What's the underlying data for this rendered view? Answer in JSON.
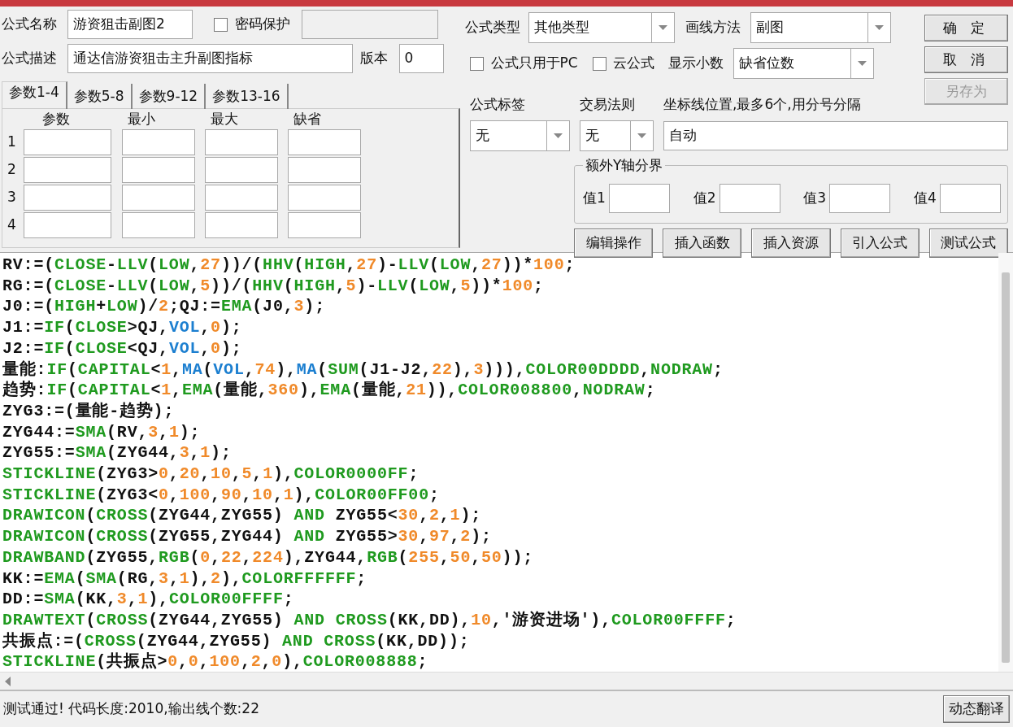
{
  "formula_name": {
    "label": "公式名称",
    "value": "游资狙击副图2"
  },
  "password_protect": {
    "label": "密码保护",
    "checked": false,
    "field_disabled": true
  },
  "description": {
    "label": "公式描述",
    "value": "通达信游资狙击主升副图指标"
  },
  "version": {
    "label": "版本",
    "value": "0"
  },
  "param_tabs": [
    {
      "label": "参数1-4",
      "selected": true
    },
    {
      "label": "参数5-8",
      "selected": false
    },
    {
      "label": "参数9-12",
      "selected": false
    },
    {
      "label": "参数13-16",
      "selected": false
    }
  ],
  "param_table": {
    "columns": [
      "参数",
      "最小",
      "最大",
      "缺省"
    ],
    "rows": [
      "1",
      "2",
      "3",
      "4"
    ]
  },
  "formula_type": {
    "label": "公式类型",
    "value": "其他类型"
  },
  "draw_method": {
    "label": "画线方法",
    "value": "副图"
  },
  "pc_only": {
    "label": "公式只用于PC",
    "checked": false
  },
  "cloud": {
    "label": "云公式",
    "checked": false
  },
  "decimals": {
    "label": "显示小数",
    "value": "缺省位数"
  },
  "side_buttons": [
    {
      "label": "确 定",
      "disabled": false
    },
    {
      "label": "取 消",
      "disabled": false
    },
    {
      "label": "另存为",
      "disabled": true
    }
  ],
  "formula_tag": {
    "label": "公式标签",
    "value": "无"
  },
  "trade_rule": {
    "label": "交易法则",
    "value": "无"
  },
  "axis_lines": {
    "label": "坐标线位置,最多6个,用分号分隔",
    "value": "自动"
  },
  "extra_y": {
    "title": "额外Y轴分界",
    "fields": [
      "值1",
      "值2",
      "值3",
      "值4"
    ]
  },
  "tool_buttons": [
    "编辑操作",
    "插入函数",
    "插入资源",
    "引入公式",
    "测试公式"
  ],
  "code_lines": [
    [
      {
        "kind": "plain",
        "text": "RV:=("
      },
      {
        "kind": "func",
        "text": "CLOSE"
      },
      {
        "kind": "plain",
        "text": "-"
      },
      {
        "kind": "func",
        "text": "LLV"
      },
      {
        "kind": "plain",
        "text": "("
      },
      {
        "kind": "func",
        "text": "LOW"
      },
      {
        "kind": "plain",
        "text": ","
      },
      {
        "kind": "num",
        "text": "27"
      },
      {
        "kind": "plain",
        "text": "))/("
      },
      {
        "kind": "func",
        "text": "HHV"
      },
      {
        "kind": "plain",
        "text": "("
      },
      {
        "kind": "func",
        "text": "HIGH"
      },
      {
        "kind": "plain",
        "text": ","
      },
      {
        "kind": "num",
        "text": "27"
      },
      {
        "kind": "plain",
        "text": ")-"
      },
      {
        "kind": "func",
        "text": "LLV"
      },
      {
        "kind": "plain",
        "text": "("
      },
      {
        "kind": "func",
        "text": "LOW"
      },
      {
        "kind": "plain",
        "text": ","
      },
      {
        "kind": "num",
        "text": "27"
      },
      {
        "kind": "plain",
        "text": "))*"
      },
      {
        "kind": "num",
        "text": "100"
      },
      {
        "kind": "plain",
        "text": ";"
      }
    ],
    [
      {
        "kind": "plain",
        "text": "RG:=("
      },
      {
        "kind": "func",
        "text": "CLOSE"
      },
      {
        "kind": "plain",
        "text": "-"
      },
      {
        "kind": "func",
        "text": "LLV"
      },
      {
        "kind": "plain",
        "text": "("
      },
      {
        "kind": "func",
        "text": "LOW"
      },
      {
        "kind": "plain",
        "text": ","
      },
      {
        "kind": "num",
        "text": "5"
      },
      {
        "kind": "plain",
        "text": "))/("
      },
      {
        "kind": "func",
        "text": "HHV"
      },
      {
        "kind": "plain",
        "text": "("
      },
      {
        "kind": "func",
        "text": "HIGH"
      },
      {
        "kind": "plain",
        "text": ","
      },
      {
        "kind": "num",
        "text": "5"
      },
      {
        "kind": "plain",
        "text": ")-"
      },
      {
        "kind": "func",
        "text": "LLV"
      },
      {
        "kind": "plain",
        "text": "("
      },
      {
        "kind": "func",
        "text": "LOW"
      },
      {
        "kind": "plain",
        "text": ","
      },
      {
        "kind": "num",
        "text": "5"
      },
      {
        "kind": "plain",
        "text": "))*"
      },
      {
        "kind": "num",
        "text": "100"
      },
      {
        "kind": "plain",
        "text": ";"
      }
    ],
    [
      {
        "kind": "plain",
        "text": "J0:=("
      },
      {
        "kind": "func",
        "text": "HIGH"
      },
      {
        "kind": "plain",
        "text": "+"
      },
      {
        "kind": "func",
        "text": "LOW"
      },
      {
        "kind": "plain",
        "text": ")/"
      },
      {
        "kind": "num",
        "text": "2"
      },
      {
        "kind": "plain",
        "text": ";QJ:="
      },
      {
        "kind": "func",
        "text": "EMA"
      },
      {
        "kind": "plain",
        "text": "(J0,"
      },
      {
        "kind": "num",
        "text": "3"
      },
      {
        "kind": "plain",
        "text": ");"
      }
    ],
    [
      {
        "kind": "plain",
        "text": "J1:="
      },
      {
        "kind": "func",
        "text": "IF"
      },
      {
        "kind": "plain",
        "text": "("
      },
      {
        "kind": "func",
        "text": "CLOSE"
      },
      {
        "kind": "plain",
        "text": ">QJ,"
      },
      {
        "kind": "builtin",
        "text": "VOL"
      },
      {
        "kind": "plain",
        "text": ","
      },
      {
        "kind": "num",
        "text": "0"
      },
      {
        "kind": "plain",
        "text": ");"
      }
    ],
    [
      {
        "kind": "plain",
        "text": "J2:="
      },
      {
        "kind": "func",
        "text": "IF"
      },
      {
        "kind": "plain",
        "text": "("
      },
      {
        "kind": "func",
        "text": "CLOSE"
      },
      {
        "kind": "plain",
        "text": "<QJ,"
      },
      {
        "kind": "builtin",
        "text": "VOL"
      },
      {
        "kind": "plain",
        "text": ","
      },
      {
        "kind": "num",
        "text": "0"
      },
      {
        "kind": "plain",
        "text": ");"
      }
    ],
    [
      {
        "kind": "plain",
        "text": "量能:"
      },
      {
        "kind": "func",
        "text": "IF"
      },
      {
        "kind": "plain",
        "text": "("
      },
      {
        "kind": "func",
        "text": "CAPITAL"
      },
      {
        "kind": "plain",
        "text": "<"
      },
      {
        "kind": "num",
        "text": "1"
      },
      {
        "kind": "plain",
        "text": ","
      },
      {
        "kind": "builtin",
        "text": "MA"
      },
      {
        "kind": "plain",
        "text": "("
      },
      {
        "kind": "builtin",
        "text": "VOL"
      },
      {
        "kind": "plain",
        "text": ","
      },
      {
        "kind": "num",
        "text": "74"
      },
      {
        "kind": "plain",
        "text": "),"
      },
      {
        "kind": "builtin",
        "text": "MA"
      },
      {
        "kind": "plain",
        "text": "("
      },
      {
        "kind": "func",
        "text": "SUM"
      },
      {
        "kind": "plain",
        "text": "(J1-J2,"
      },
      {
        "kind": "num",
        "text": "22"
      },
      {
        "kind": "plain",
        "text": "),"
      },
      {
        "kind": "num",
        "text": "3"
      },
      {
        "kind": "plain",
        "text": "))),"
      },
      {
        "kind": "func",
        "text": "COLOR00DDDD"
      },
      {
        "kind": "plain",
        "text": ","
      },
      {
        "kind": "func",
        "text": "NODRAW"
      },
      {
        "kind": "plain",
        "text": ";"
      }
    ],
    [
      {
        "kind": "plain",
        "text": "趋势:"
      },
      {
        "kind": "func",
        "text": "IF"
      },
      {
        "kind": "plain",
        "text": "("
      },
      {
        "kind": "func",
        "text": "CAPITAL"
      },
      {
        "kind": "plain",
        "text": "<"
      },
      {
        "kind": "num",
        "text": "1"
      },
      {
        "kind": "plain",
        "text": ","
      },
      {
        "kind": "func",
        "text": "EMA"
      },
      {
        "kind": "plain",
        "text": "(量能,"
      },
      {
        "kind": "num",
        "text": "360"
      },
      {
        "kind": "plain",
        "text": "),"
      },
      {
        "kind": "func",
        "text": "EMA"
      },
      {
        "kind": "plain",
        "text": "(量能,"
      },
      {
        "kind": "num",
        "text": "21"
      },
      {
        "kind": "plain",
        "text": ")),"
      },
      {
        "kind": "func",
        "text": "COLOR008800"
      },
      {
        "kind": "plain",
        "text": ","
      },
      {
        "kind": "func",
        "text": "NODRAW"
      },
      {
        "kind": "plain",
        "text": ";"
      }
    ],
    [
      {
        "kind": "plain",
        "text": "ZYG3:=(量能-趋势);"
      }
    ],
    [
      {
        "kind": "plain",
        "text": "ZYG44:="
      },
      {
        "kind": "func",
        "text": "SMA"
      },
      {
        "kind": "plain",
        "text": "(RV,"
      },
      {
        "kind": "num",
        "text": "3"
      },
      {
        "kind": "plain",
        "text": ","
      },
      {
        "kind": "num",
        "text": "1"
      },
      {
        "kind": "plain",
        "text": ");"
      }
    ],
    [
      {
        "kind": "plain",
        "text": "ZYG55:="
      },
      {
        "kind": "func",
        "text": "SMA"
      },
      {
        "kind": "plain",
        "text": "(ZYG44,"
      },
      {
        "kind": "num",
        "text": "3"
      },
      {
        "kind": "plain",
        "text": ","
      },
      {
        "kind": "num",
        "text": "1"
      },
      {
        "kind": "plain",
        "text": ");"
      }
    ],
    [
      {
        "kind": "func",
        "text": "STICKLINE"
      },
      {
        "kind": "plain",
        "text": "(ZYG3>"
      },
      {
        "kind": "num",
        "text": "0"
      },
      {
        "kind": "plain",
        "text": ","
      },
      {
        "kind": "num",
        "text": "20"
      },
      {
        "kind": "plain",
        "text": ","
      },
      {
        "kind": "num",
        "text": "10"
      },
      {
        "kind": "plain",
        "text": ","
      },
      {
        "kind": "num",
        "text": "5"
      },
      {
        "kind": "plain",
        "text": ","
      },
      {
        "kind": "num",
        "text": "1"
      },
      {
        "kind": "plain",
        "text": "),"
      },
      {
        "kind": "func",
        "text": "COLOR0000FF"
      },
      {
        "kind": "plain",
        "text": ";"
      }
    ],
    [
      {
        "kind": "func",
        "text": "STICKLINE"
      },
      {
        "kind": "plain",
        "text": "(ZYG3<"
      },
      {
        "kind": "num",
        "text": "0"
      },
      {
        "kind": "plain",
        "text": ","
      },
      {
        "kind": "num",
        "text": "100"
      },
      {
        "kind": "plain",
        "text": ","
      },
      {
        "kind": "num",
        "text": "90"
      },
      {
        "kind": "plain",
        "text": ","
      },
      {
        "kind": "num",
        "text": "10"
      },
      {
        "kind": "plain",
        "text": ","
      },
      {
        "kind": "num",
        "text": "1"
      },
      {
        "kind": "plain",
        "text": "),"
      },
      {
        "kind": "func",
        "text": "COLOR00FF00"
      },
      {
        "kind": "plain",
        "text": ";"
      }
    ],
    [
      {
        "kind": "func",
        "text": "DRAWICON"
      },
      {
        "kind": "plain",
        "text": "("
      },
      {
        "kind": "func",
        "text": "CROSS"
      },
      {
        "kind": "plain",
        "text": "(ZYG44,ZYG55) "
      },
      {
        "kind": "func",
        "text": "AND"
      },
      {
        "kind": "plain",
        "text": " ZYG55<"
      },
      {
        "kind": "num",
        "text": "30"
      },
      {
        "kind": "plain",
        "text": ","
      },
      {
        "kind": "num",
        "text": "2"
      },
      {
        "kind": "plain",
        "text": ","
      },
      {
        "kind": "num",
        "text": "1"
      },
      {
        "kind": "plain",
        "text": ");"
      }
    ],
    [
      {
        "kind": "func",
        "text": "DRAWICON"
      },
      {
        "kind": "plain",
        "text": "("
      },
      {
        "kind": "func",
        "text": "CROSS"
      },
      {
        "kind": "plain",
        "text": "(ZYG55,ZYG44) "
      },
      {
        "kind": "func",
        "text": "AND"
      },
      {
        "kind": "plain",
        "text": " ZYG55>"
      },
      {
        "kind": "num",
        "text": "30"
      },
      {
        "kind": "plain",
        "text": ","
      },
      {
        "kind": "num",
        "text": "97"
      },
      {
        "kind": "plain",
        "text": ","
      },
      {
        "kind": "num",
        "text": "2"
      },
      {
        "kind": "plain",
        "text": ");"
      }
    ],
    [
      {
        "kind": "func",
        "text": "DRAWBAND"
      },
      {
        "kind": "plain",
        "text": "(ZYG55,"
      },
      {
        "kind": "func",
        "text": "RGB"
      },
      {
        "kind": "plain",
        "text": "("
      },
      {
        "kind": "num",
        "text": "0"
      },
      {
        "kind": "plain",
        "text": ","
      },
      {
        "kind": "num",
        "text": "22"
      },
      {
        "kind": "plain",
        "text": ","
      },
      {
        "kind": "num",
        "text": "224"
      },
      {
        "kind": "plain",
        "text": "),ZYG44,"
      },
      {
        "kind": "func",
        "text": "RGB"
      },
      {
        "kind": "plain",
        "text": "("
      },
      {
        "kind": "num",
        "text": "255"
      },
      {
        "kind": "plain",
        "text": ","
      },
      {
        "kind": "num",
        "text": "50"
      },
      {
        "kind": "plain",
        "text": ","
      },
      {
        "kind": "num",
        "text": "50"
      },
      {
        "kind": "plain",
        "text": "));"
      }
    ],
    [
      {
        "kind": "plain",
        "text": "KK:="
      },
      {
        "kind": "func",
        "text": "EMA"
      },
      {
        "kind": "plain",
        "text": "("
      },
      {
        "kind": "func",
        "text": "SMA"
      },
      {
        "kind": "plain",
        "text": "(RG,"
      },
      {
        "kind": "num",
        "text": "3"
      },
      {
        "kind": "plain",
        "text": ","
      },
      {
        "kind": "num",
        "text": "1"
      },
      {
        "kind": "plain",
        "text": "),"
      },
      {
        "kind": "num",
        "text": "2"
      },
      {
        "kind": "plain",
        "text": "),"
      },
      {
        "kind": "func",
        "text": "COLORFFFFFF"
      },
      {
        "kind": "plain",
        "text": ";"
      }
    ],
    [
      {
        "kind": "plain",
        "text": "DD:="
      },
      {
        "kind": "func",
        "text": "SMA"
      },
      {
        "kind": "plain",
        "text": "(KK,"
      },
      {
        "kind": "num",
        "text": "3"
      },
      {
        "kind": "plain",
        "text": ","
      },
      {
        "kind": "num",
        "text": "1"
      },
      {
        "kind": "plain",
        "text": "),"
      },
      {
        "kind": "func",
        "text": "COLOR00FFFF"
      },
      {
        "kind": "plain",
        "text": ";"
      }
    ],
    [
      {
        "kind": "func",
        "text": "DRAWTEXT"
      },
      {
        "kind": "plain",
        "text": "("
      },
      {
        "kind": "func",
        "text": "CROSS"
      },
      {
        "kind": "plain",
        "text": "(ZYG44,ZYG55) "
      },
      {
        "kind": "func",
        "text": "AND CROSS"
      },
      {
        "kind": "plain",
        "text": "(KK,DD),"
      },
      {
        "kind": "num",
        "text": "10"
      },
      {
        "kind": "plain",
        "text": ",'游资进场'),"
      },
      {
        "kind": "func",
        "text": "COLOR00FFFF"
      },
      {
        "kind": "plain",
        "text": ";"
      }
    ],
    [
      {
        "kind": "plain",
        "text": "共振点:=("
      },
      {
        "kind": "func",
        "text": "CROSS"
      },
      {
        "kind": "plain",
        "text": "(ZYG44,ZYG55) "
      },
      {
        "kind": "func",
        "text": "AND CROSS"
      },
      {
        "kind": "plain",
        "text": "(KK,DD));"
      }
    ],
    [
      {
        "kind": "func",
        "text": "STICKLINE"
      },
      {
        "kind": "plain",
        "text": "(共振点>"
      },
      {
        "kind": "num",
        "text": "0"
      },
      {
        "kind": "plain",
        "text": ","
      },
      {
        "kind": "num",
        "text": "0"
      },
      {
        "kind": "plain",
        "text": ","
      },
      {
        "kind": "num",
        "text": "100"
      },
      {
        "kind": "plain",
        "text": ","
      },
      {
        "kind": "num",
        "text": "2"
      },
      {
        "kind": "plain",
        "text": ","
      },
      {
        "kind": "num",
        "text": "0"
      },
      {
        "kind": "plain",
        "text": "),"
      },
      {
        "kind": "func",
        "text": "COLOR008888"
      },
      {
        "kind": "plain",
        "text": ";"
      }
    ]
  ],
  "status": "测试通过! 代码长度:2010,输出线个数:22",
  "translate_button": "动态翻译"
}
